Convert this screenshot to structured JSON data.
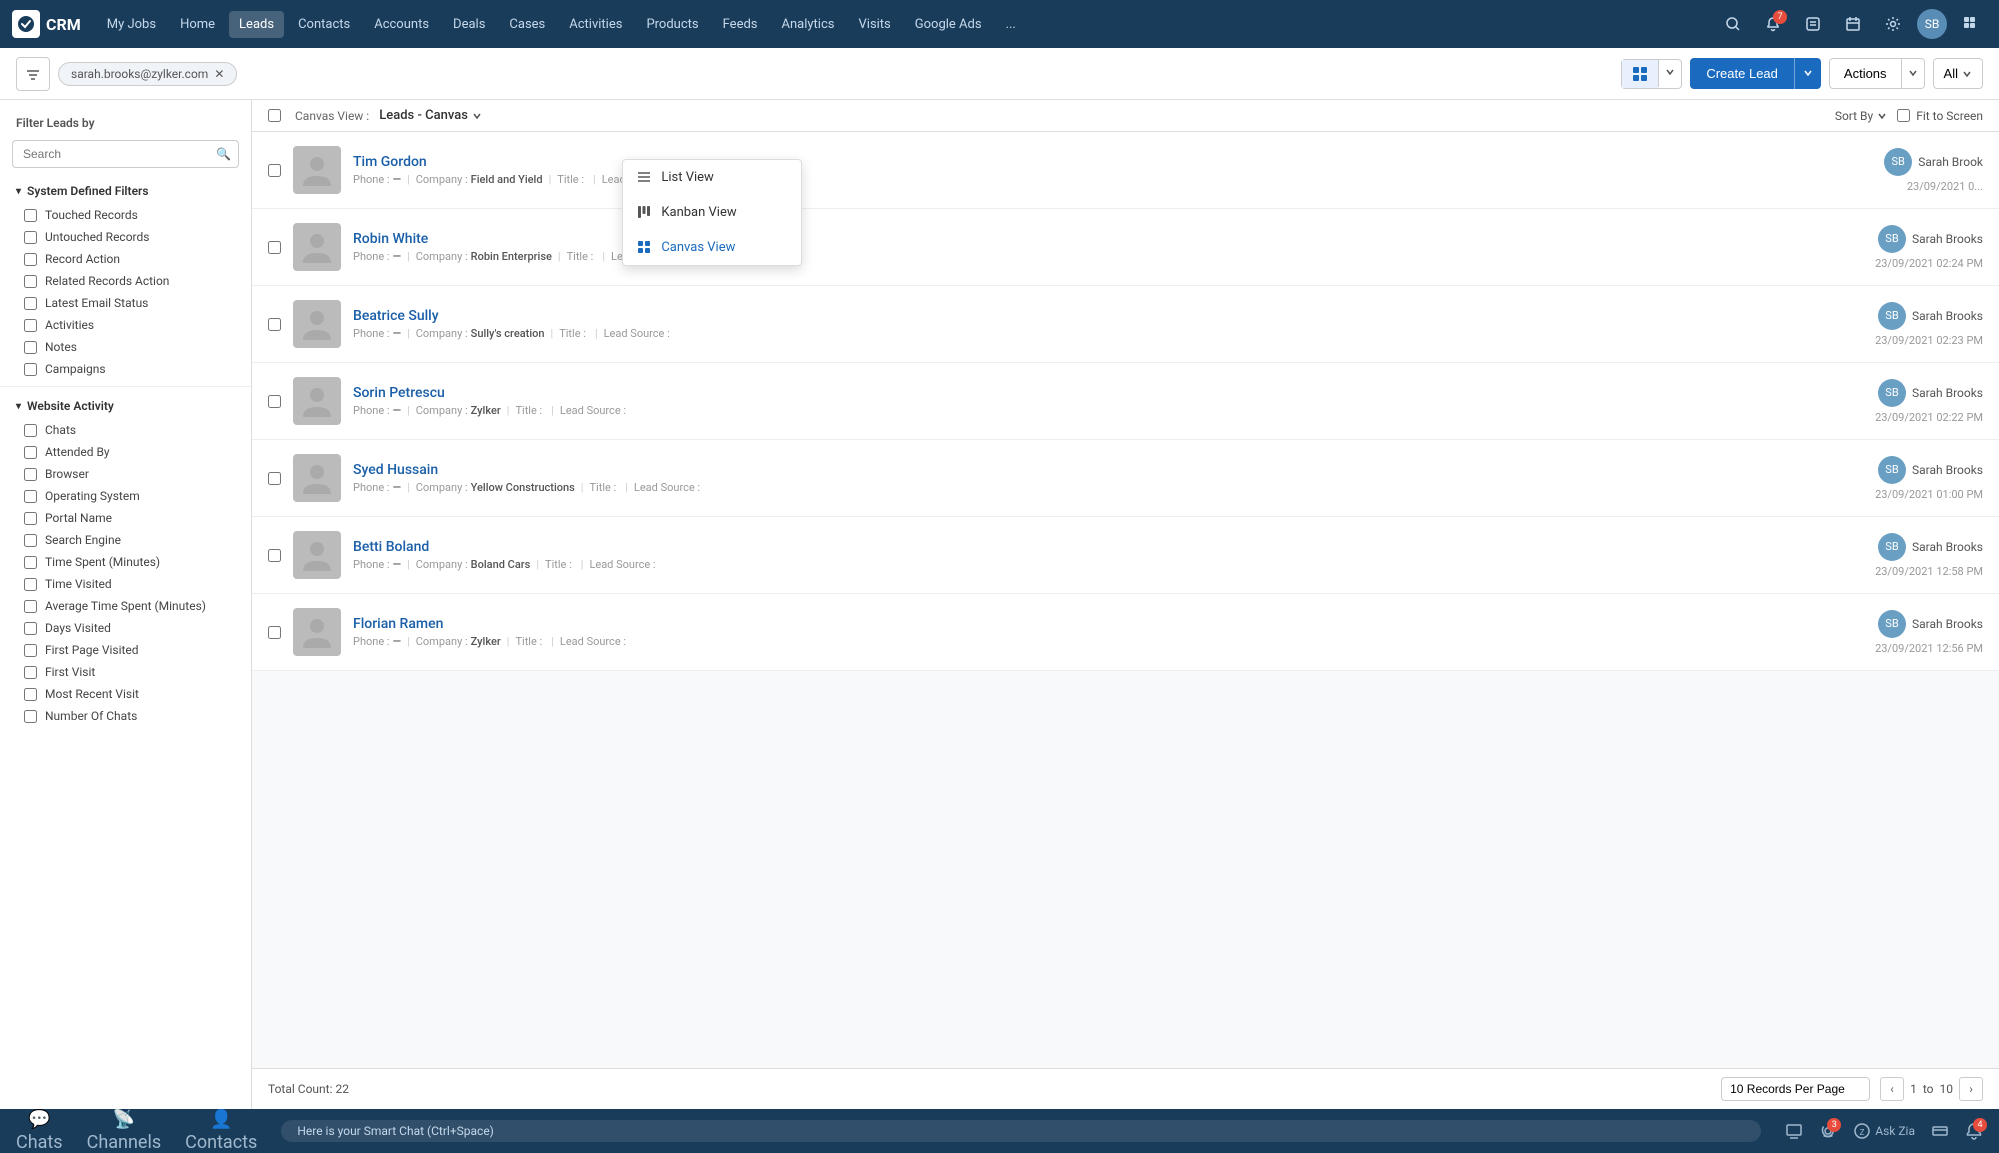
{
  "app": {
    "name": "CRM"
  },
  "topnav": {
    "items": [
      {
        "label": "My Jobs",
        "active": false
      },
      {
        "label": "Home",
        "active": false
      },
      {
        "label": "Leads",
        "active": true
      },
      {
        "label": "Contacts",
        "active": false
      },
      {
        "label": "Accounts",
        "active": false
      },
      {
        "label": "Deals",
        "active": false
      },
      {
        "label": "Cases",
        "active": false
      },
      {
        "label": "Activities",
        "active": false
      },
      {
        "label": "Products",
        "active": false
      },
      {
        "label": "Feeds",
        "active": false
      },
      {
        "label": "Analytics",
        "active": false
      },
      {
        "label": "Visits",
        "active": false
      },
      {
        "label": "Google Ads",
        "active": false
      },
      {
        "label": "...",
        "active": false
      }
    ],
    "notification_count": "7"
  },
  "toolbar": {
    "email": "sarah.brooks@zylker.com",
    "create_lead": "Create Lead",
    "actions": "Actions",
    "all": "All",
    "view_options": [
      {
        "label": "List View",
        "icon": "list"
      },
      {
        "label": "Kanban View",
        "icon": "kanban"
      },
      {
        "label": "Canvas View",
        "icon": "canvas",
        "active": true
      }
    ]
  },
  "sidebar": {
    "title": "Filter Leads by",
    "search_placeholder": "Search",
    "sections": [
      {
        "label": "System Defined Filters",
        "items": [
          {
            "label": "Touched Records"
          },
          {
            "label": "Untouched Records"
          },
          {
            "label": "Record Action"
          },
          {
            "label": "Related Records Action"
          },
          {
            "label": "Latest Email Status"
          },
          {
            "label": "Activities"
          },
          {
            "label": "Notes"
          },
          {
            "label": "Campaigns"
          }
        ]
      },
      {
        "label": "Website Activity",
        "items": [
          {
            "label": "Chats"
          },
          {
            "label": "Attended By"
          },
          {
            "label": "Browser"
          },
          {
            "label": "Operating System"
          },
          {
            "label": "Portal Name"
          },
          {
            "label": "Search Engine"
          },
          {
            "label": "Time Spent (Minutes)"
          },
          {
            "label": "Time Visited"
          },
          {
            "label": "Average Time Spent (Minutes)"
          },
          {
            "label": "Days Visited"
          },
          {
            "label": "First Page Visited"
          },
          {
            "label": "First Visit"
          },
          {
            "label": "Most Recent Visit"
          },
          {
            "label": "Number Of Chats"
          }
        ]
      }
    ]
  },
  "content": {
    "canvas_view_label": "Canvas View :",
    "canvas_view_title": "Leads - Canvas",
    "sort_by": "Sort By",
    "fit_to_screen": "Fit to Screen",
    "leads": [
      {
        "name": "Tim Gordon",
        "phone": "—",
        "company": "Field and Yield",
        "title": "",
        "lead_source": "",
        "owner": "Sarah Brook",
        "date": "23/09/2021 0..."
      },
      {
        "name": "Robin White",
        "phone": "—",
        "company": "Robin Enterprise",
        "title": "",
        "lead_source": "",
        "owner": "Sarah Brooks",
        "date": "23/09/2021 02:24 PM"
      },
      {
        "name": "Beatrice Sully",
        "phone": "—",
        "company": "Sully's creation",
        "title": "",
        "lead_source": "",
        "owner": "Sarah Brooks",
        "date": "23/09/2021 02:23 PM"
      },
      {
        "name": "Sorin Petrescu",
        "phone": "—",
        "company": "Zylker",
        "title": "",
        "lead_source": "",
        "owner": "Sarah Brooks",
        "date": "23/09/2021 02:22 PM"
      },
      {
        "name": "Syed Hussain",
        "phone": "—",
        "company": "Yellow Constructions",
        "title": "",
        "lead_source": "",
        "owner": "Sarah Brooks",
        "date": "23/09/2021 01:00 PM"
      },
      {
        "name": "Betti Boland",
        "phone": "—",
        "company": "Boland Cars",
        "title": "",
        "lead_source": "",
        "owner": "Sarah Brooks",
        "date": "23/09/2021 12:58 PM"
      },
      {
        "name": "Florian Ramen",
        "phone": "—",
        "company": "Zylker",
        "title": "",
        "lead_source": "",
        "owner": "Sarah Brooks",
        "date": "23/09/2021 12:56 PM"
      }
    ],
    "total_count": "Total Count: 22",
    "per_page": "10 Records Per Page",
    "pagination": {
      "current": "1",
      "separator": "to",
      "total": "10"
    }
  },
  "bottom_bar": {
    "chat_placeholder": "Here is your Smart Chat (Ctrl+Space)",
    "items": [
      {
        "label": "Chats",
        "icon": "💬"
      },
      {
        "label": "Channels",
        "icon": "📡"
      },
      {
        "label": "Contacts",
        "icon": "👤"
      }
    ],
    "ask_zia": "Ask Zia",
    "badge1": "3",
    "badge2": "4"
  },
  "icons": {
    "search": "🔍",
    "filter": "⊟",
    "list_view": "☰",
    "kanban_view": "⊞",
    "canvas_view": "⊡",
    "chevron_down": "▾",
    "chevron_right": "›",
    "sort": "⇅",
    "prev": "‹",
    "next": "›",
    "notifications": "🔔",
    "calendar": "📅",
    "clock": "🕐",
    "settings": "⚙",
    "apps": "⊞"
  }
}
